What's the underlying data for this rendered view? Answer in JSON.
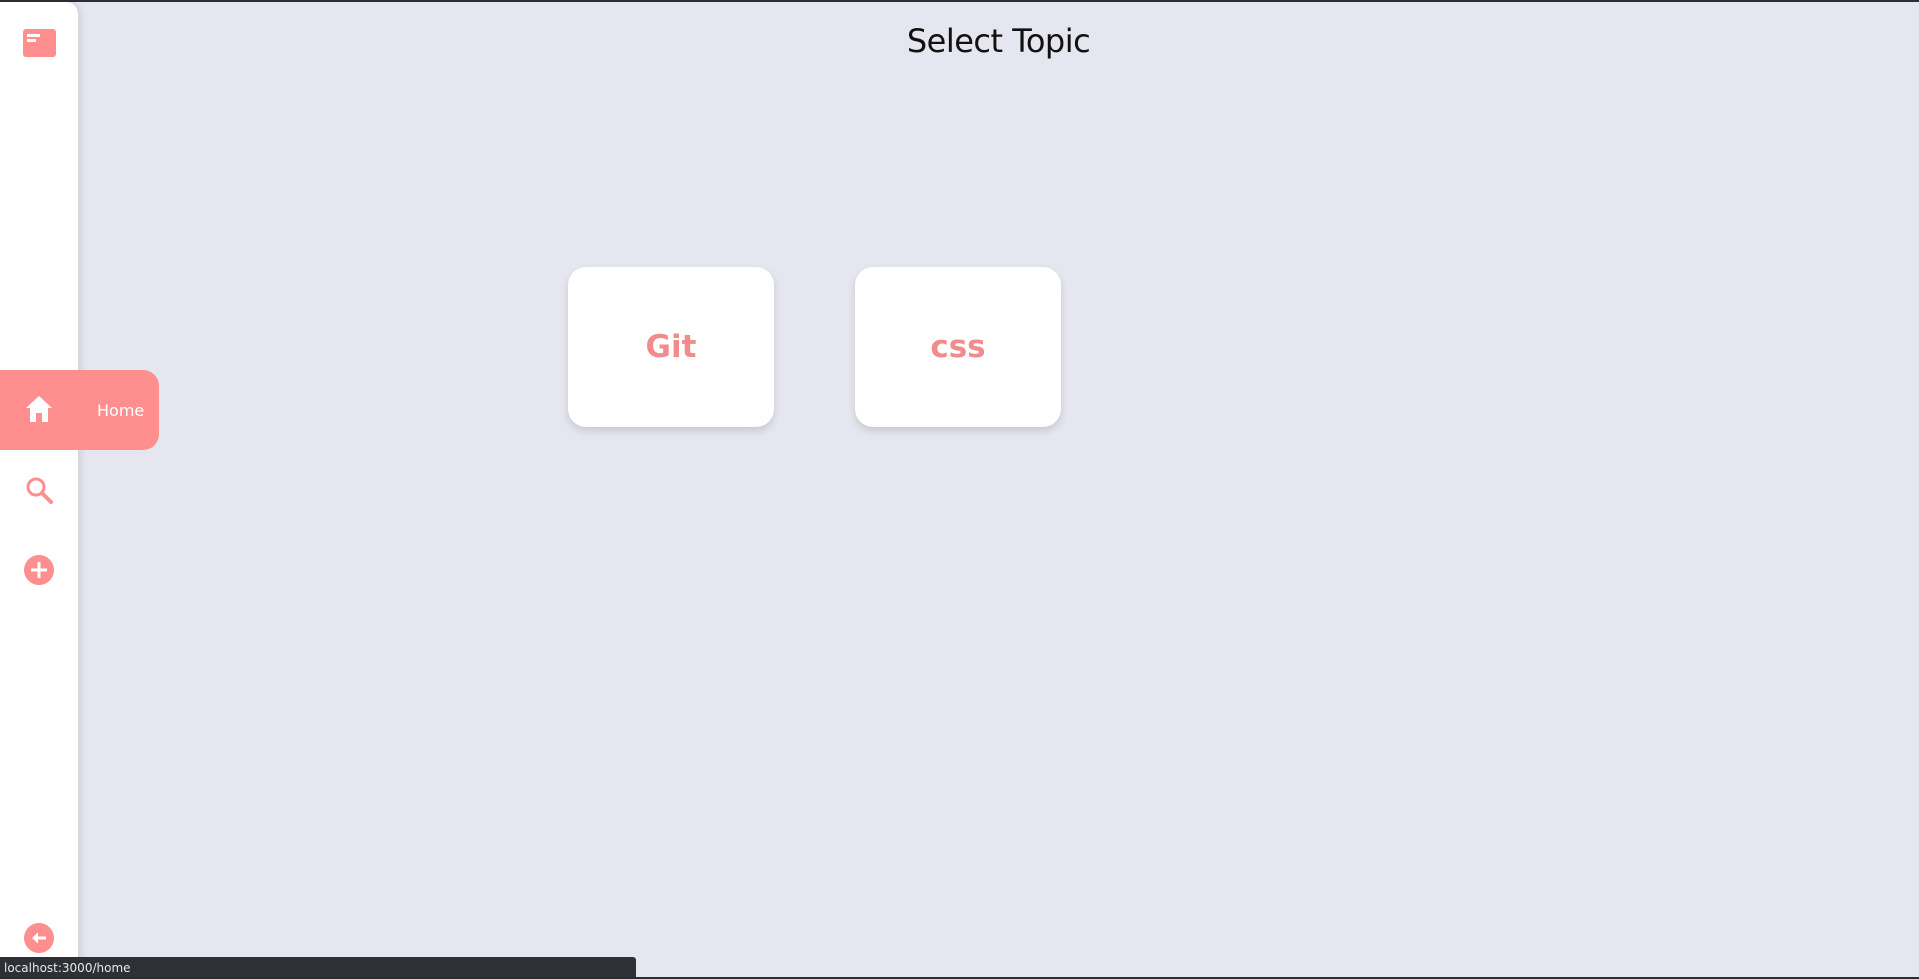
{
  "page": {
    "title": "Select Topic"
  },
  "sidebar": {
    "logo": {
      "icon": "browser-window-icon"
    },
    "items": [
      {
        "id": "home",
        "icon": "home-icon",
        "label": "Home",
        "active": true
      },
      {
        "id": "search",
        "icon": "search-icon"
      },
      {
        "id": "add",
        "icon": "plus-circle-icon"
      }
    ],
    "footer": {
      "icon": "arrow-left-circle-icon"
    }
  },
  "topics": [
    {
      "label": "Git"
    },
    {
      "label": "css"
    }
  ],
  "status_bar": {
    "url": "localhost:3000/home"
  },
  "colors": {
    "accent": "#ff8e8e",
    "card_text": "#f28b8b",
    "background": "#e5e6ef",
    "sidebar": "#ffffff"
  }
}
